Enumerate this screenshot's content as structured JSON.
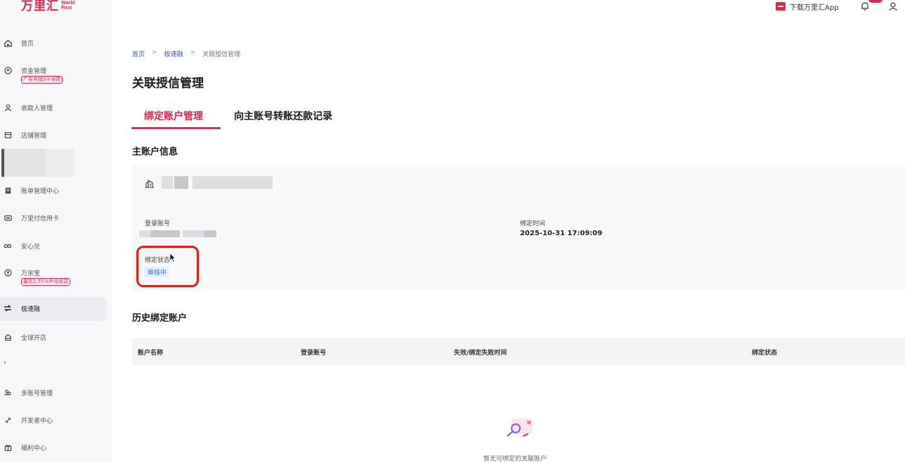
{
  "logo": {
    "brand": "万里汇",
    "sub1": "World",
    "sub2": "First"
  },
  "topbar": {
    "download_label": "下载万里汇App"
  },
  "sidebar": {
    "items": [
      {
        "label": "首页",
        "icon": "home-icon"
      },
      {
        "label": "资金管理",
        "badge": "广告充值0手续费",
        "icon": "fund-icon"
      },
      {
        "label": "收款人管理",
        "icon": "payee-icon"
      },
      {
        "label": "店铺管理",
        "icon": "store-icon"
      },
      {
        "label": "账单管理中心",
        "icon": "bill-icon"
      },
      {
        "label": "万里付信用卡",
        "icon": "card-icon"
      },
      {
        "label": "安心兑",
        "icon": "exchange-icon"
      },
      {
        "label": "万余宝",
        "badge": "最高1.55%年化收益",
        "icon": "wealth-icon"
      },
      {
        "label": "极速融",
        "icon": "finance-icon"
      },
      {
        "label": "全球开店",
        "icon": "global-store-icon"
      },
      {
        "label": "多账号管理",
        "icon": "multi-account-icon"
      },
      {
        "label": "开发者中心",
        "icon": "developer-icon"
      },
      {
        "label": "福利中心",
        "icon": "gift-icon"
      }
    ]
  },
  "breadcrumb": {
    "items": [
      "首页",
      "极速融",
      "关联授信管理"
    ],
    "sep": ">"
  },
  "page": {
    "title": "关联授信管理"
  },
  "tabs": [
    {
      "label": "绑定账户管理",
      "active": true
    },
    {
      "label": "向主账号转账还款记录",
      "active": false
    }
  ],
  "main_account": {
    "section_title": "主账户信息",
    "login_label": "登录账号",
    "bind_time_label": "绑定时间",
    "bind_time_value": "2025-10-31 17:09:09",
    "status_label": "绑定状态",
    "status_value": "审核中"
  },
  "history": {
    "section_title": "历史绑定账户",
    "columns": [
      "账户名称",
      "登录账号",
      "失效/绑定失败时间",
      "绑定状态"
    ],
    "empty_text": "暂无可绑定的关联账户"
  },
  "colors": {
    "accent": "#e2264d",
    "status_blue": "#2e7ad6",
    "highlight": "#e0201d"
  }
}
